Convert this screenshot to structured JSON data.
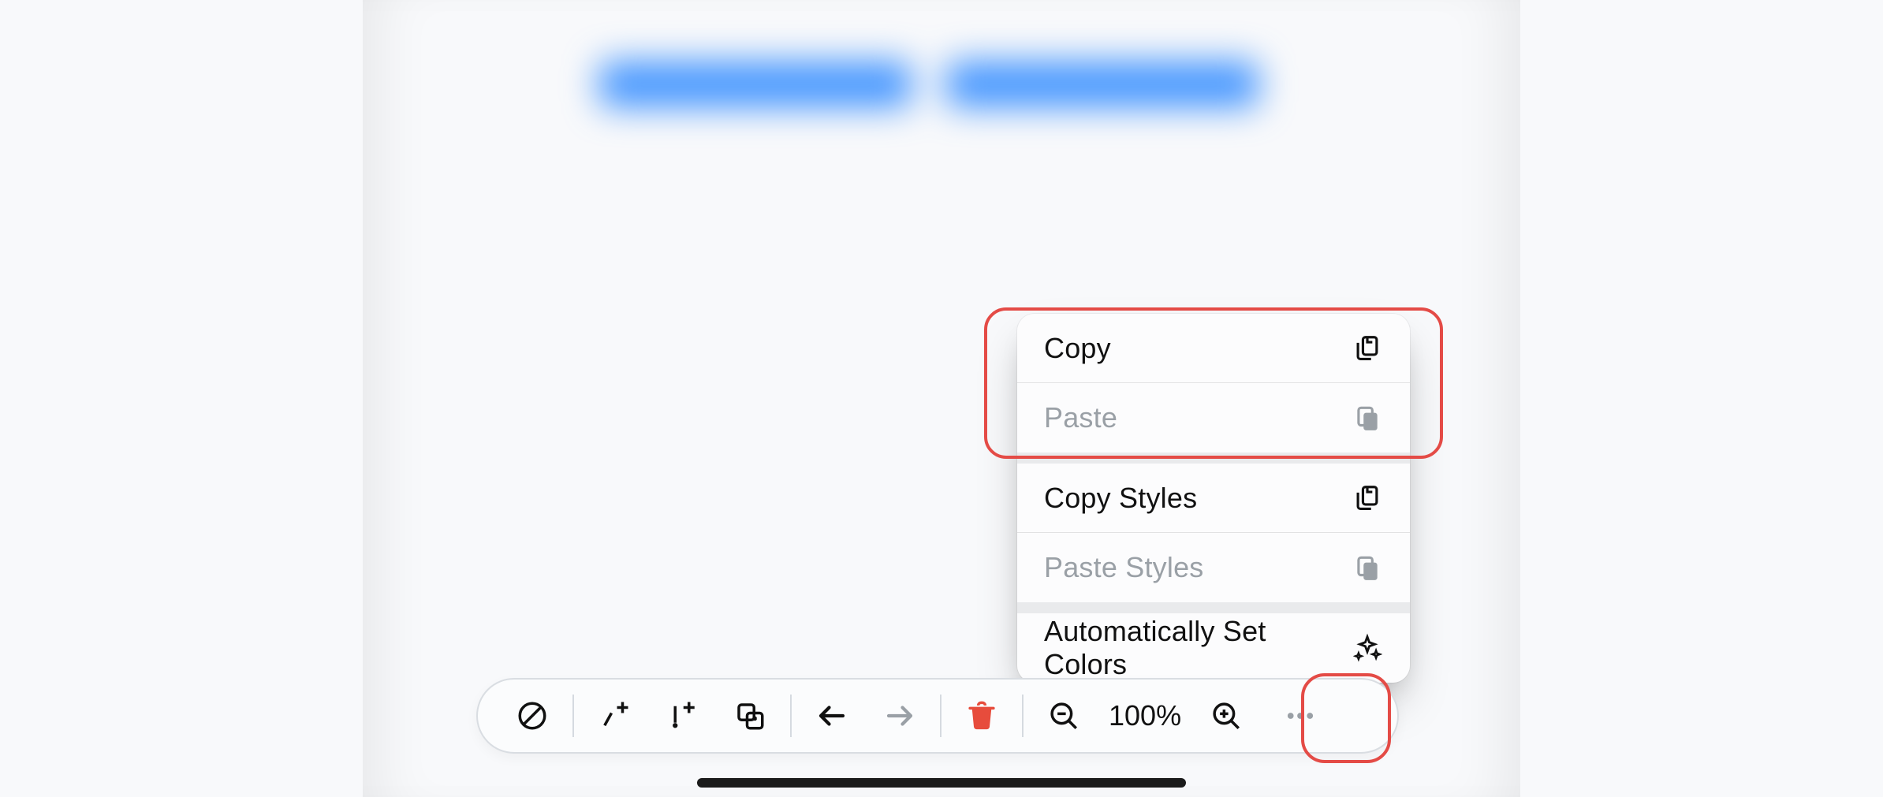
{
  "contextMenu": {
    "copy": {
      "label": "Copy"
    },
    "paste": {
      "label": "Paste"
    },
    "copyStyles": {
      "label": "Copy Styles"
    },
    "pasteStyles": {
      "label": "Paste Styles"
    },
    "autoColors": {
      "label": "Automatically Set Colors"
    }
  },
  "toolbar": {
    "zoomLabel": "100%"
  },
  "colors": {
    "accentRed": "#e44b46",
    "deleteRed": "#e74c3c",
    "mutedGrey": "#9aa0a6"
  }
}
